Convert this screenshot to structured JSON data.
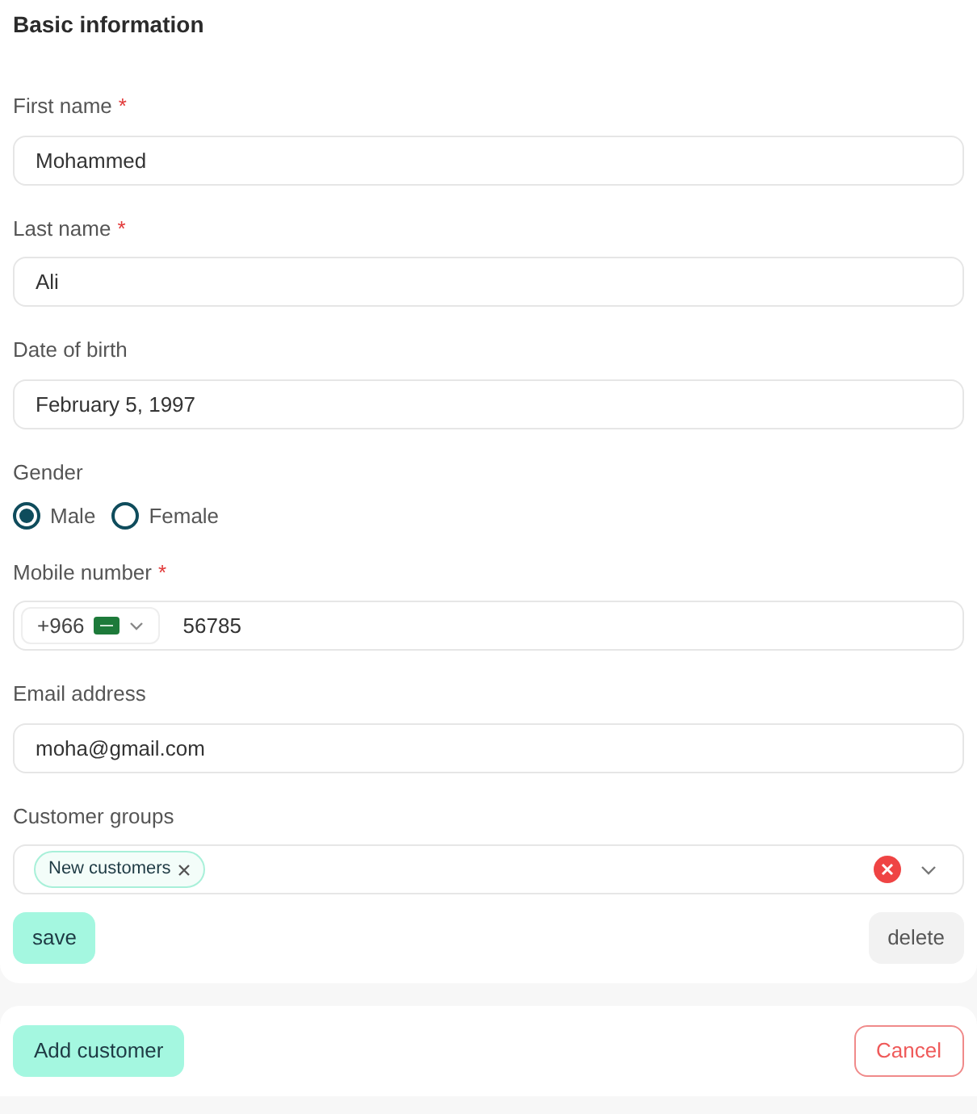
{
  "section_title": "Basic information",
  "fields": [
    {
      "kind": "text",
      "label": "First name",
      "required_mark": "*",
      "value": "Mohammed"
    },
    {
      "kind": "text",
      "label": "Last name",
      "required_mark": "*",
      "value": "Ali"
    },
    {
      "kind": "text",
      "label": "Date of birth",
      "value": "February 5, 1997"
    },
    {
      "kind": "radio",
      "label": "Gender",
      "options": [
        {
          "label": "Male",
          "selected": true
        },
        {
          "label": "Female",
          "selected": false
        }
      ]
    },
    {
      "kind": "phone",
      "label": "Mobile number",
      "required_mark": "*",
      "code": "+966",
      "value": "56785"
    },
    {
      "kind": "text",
      "label": "Email address",
      "value": "moha@gmail.com"
    },
    {
      "kind": "tags",
      "label": "Customer groups",
      "tags": [
        "New customers"
      ]
    }
  ],
  "form_buttons": {
    "save": "save",
    "delete": "delete"
  },
  "footer": {
    "primary": "Add customer",
    "cancel": "Cancel"
  }
}
